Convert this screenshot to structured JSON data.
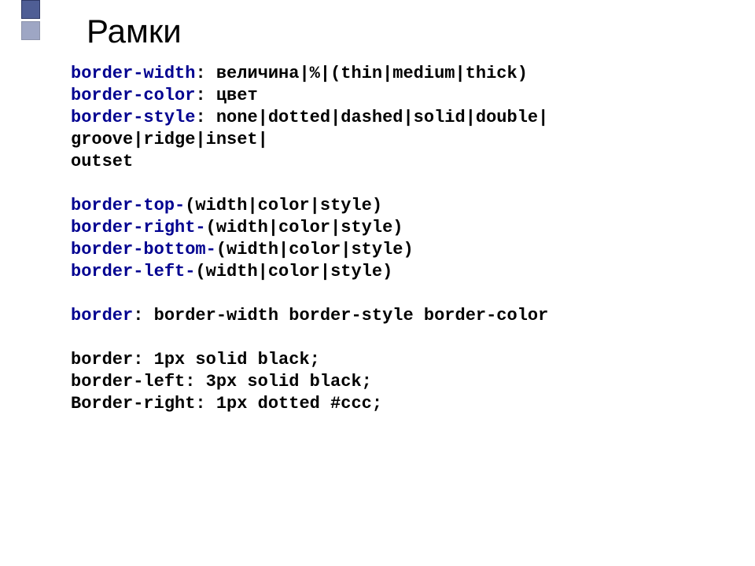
{
  "title": "Рамки",
  "lines": [
    [
      {
        "t": "border-width",
        "kw": true
      },
      {
        "t": ": величина|%|(thin|medium|thick)",
        "kw": false
      }
    ],
    [
      {
        "t": "border-color",
        "kw": true
      },
      {
        "t": ": цвет",
        "kw": false
      }
    ],
    [
      {
        "t": "border-style",
        "kw": true
      },
      {
        "t": ": none|dotted|dashed|solid|double|",
        "kw": false
      }
    ],
    [
      {
        "t": "groove|ridge|inset|",
        "kw": false
      }
    ],
    [
      {
        "t": "outset",
        "kw": false
      }
    ],
    [
      {
        "t": "",
        "kw": false
      }
    ],
    [
      {
        "t": "border-top-",
        "kw": true
      },
      {
        "t": "(width|color|style)",
        "kw": false
      }
    ],
    [
      {
        "t": "border-right-",
        "kw": true
      },
      {
        "t": "(width|color|style)",
        "kw": false
      }
    ],
    [
      {
        "t": "border-bottom-",
        "kw": true
      },
      {
        "t": "(width|color|style)",
        "kw": false
      }
    ],
    [
      {
        "t": "border-left-",
        "kw": true
      },
      {
        "t": "(width|color|style)",
        "kw": false
      }
    ],
    [
      {
        "t": "",
        "kw": false
      }
    ],
    [
      {
        "t": "border",
        "kw": true
      },
      {
        "t": ": border-width border-style border-color",
        "kw": false
      }
    ],
    [
      {
        "t": "",
        "kw": false
      }
    ],
    [
      {
        "t": "border: 1px solid black;",
        "kw": false
      }
    ],
    [
      {
        "t": "border-left: 3px solid black;",
        "kw": false
      }
    ],
    [
      {
        "t": "Border-right: 1px dotted #ccc;",
        "kw": false
      }
    ]
  ]
}
